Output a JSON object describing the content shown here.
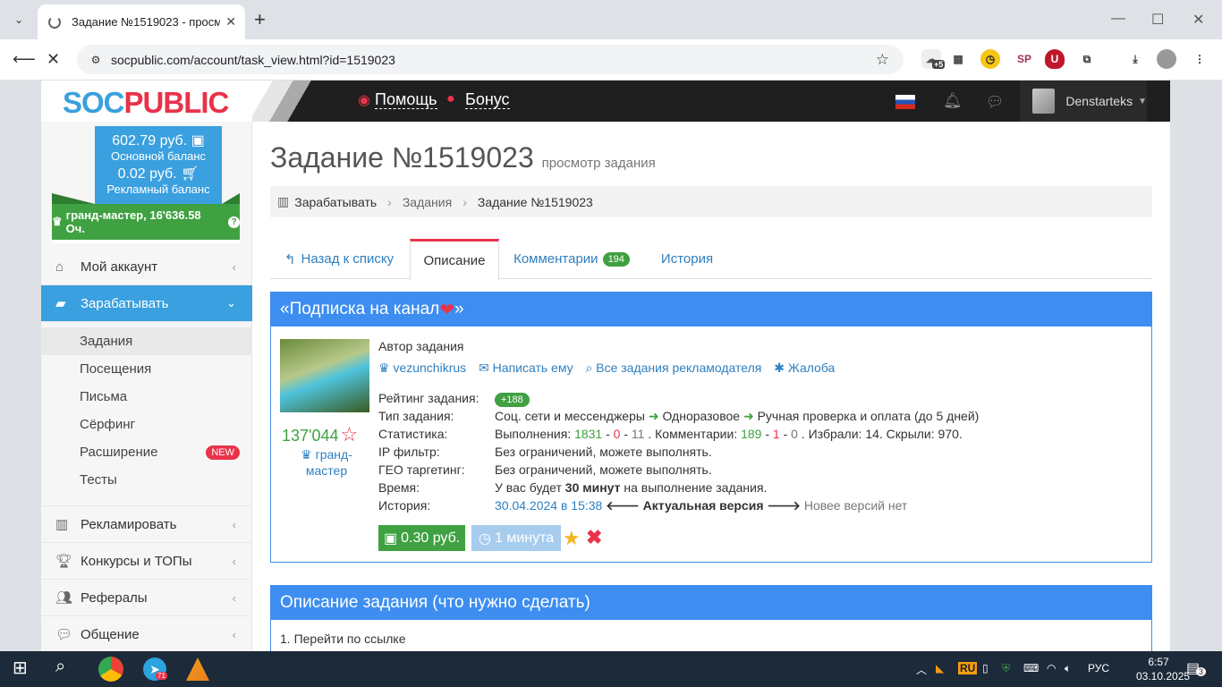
{
  "browser": {
    "tab_title": "Задание №1519023 - просмотр з",
    "url": "socpublic.com/account/task_view.html?id=1519023",
    "ext_badge_count": "+5"
  },
  "site": {
    "logo_part1": "SOC",
    "logo_part2": "PUBLIC",
    "nav_help": "Помощь",
    "nav_bonus": "Бонус",
    "username": "Denstarteks"
  },
  "balance": {
    "main_amount": "602.79 руб.",
    "main_label": "Основной баланс",
    "ad_amount": "0.02 руб.",
    "ad_label": "Рекламный баланс",
    "rank": "гранд-мастер, 16'636.58 Оч."
  },
  "menu": {
    "account": "Мой аккаунт",
    "earn": "Зарабатывать",
    "sub": [
      "Задания",
      "Посещения",
      "Письма",
      "Сёрфинг",
      "Расширение",
      "Тесты"
    ],
    "new_badge": "NEW",
    "advertise": "Рекламировать",
    "contests": "Конкурсы и ТОПы",
    "referrals": "Рефералы",
    "communication": "Общение"
  },
  "main": {
    "title": "Задание №1519023",
    "subtitle": "просмотр задания",
    "crumbs": [
      "Зарабатывать",
      "Задания",
      "Задание №1519023"
    ],
    "tabs": {
      "back": "Назад к списку",
      "description": "Описание",
      "comments": "Комментарии",
      "comments_count": "194",
      "history": "История"
    }
  },
  "task": {
    "header": "«Подписка на канал",
    "header_end": "»",
    "author_label": "Автор задания",
    "author_name": "vezunchikrus",
    "write_him": "Написать ему",
    "all_tasks": "Все задания рекламодателя",
    "complaint": "Жалоба",
    "author_rating": "137'044",
    "author_rank": "гранд-мастер",
    "rating_label": "Рейтинг задания:",
    "rating_value": "+188",
    "type_label": "Тип задания:",
    "type_1": "Соц. сети и мессенджеры",
    "type_2": "Одноразовое",
    "type_3": "Ручная проверка и оплата (до 5 дней)",
    "stats_label": "Статистика:",
    "stats_done": "Выполнения:",
    "stats_n1": "1831",
    "stats_n2": "0",
    "stats_n3": "11",
    "stats_comments": ". Комментарии:",
    "stats_c1": "189",
    "stats_c2": "1",
    "stats_c3": "0",
    "stats_tail": ". Избрали: 14. Скрыли: 970.",
    "ip_label": "IP фильтр:",
    "ip_value": "Без ограничений, можете выполнять.",
    "geo_label": "ГЕО таргетинг:",
    "geo_value": "Без ограничений, можете выполнять.",
    "time_label": "Время:",
    "time_pre": "У вас будет",
    "time_bold": "30 минут",
    "time_post": "на выполнение задания.",
    "history_label": "История:",
    "history_date": "30.04.2024 в 15:38",
    "history_current": "Актуальная версия",
    "history_none": "Новее версий нет",
    "price": "0.30 руб.",
    "duration": "1 минута"
  },
  "description": {
    "header": "Описание задания (что нужно сделать)",
    "step1": "1. Перейти по ссылке"
  },
  "taskbar": {
    "lang_badge": "RU",
    "lang": "РУС",
    "time": "6:57",
    "date": "03.10.2025",
    "telegram_badge": "71",
    "notif_count": "3"
  },
  "colors": {
    "accent_blue": "#3aa0df",
    "panel_blue": "#3d8ef0",
    "green": "#3fa142",
    "red": "#e8334a"
  }
}
